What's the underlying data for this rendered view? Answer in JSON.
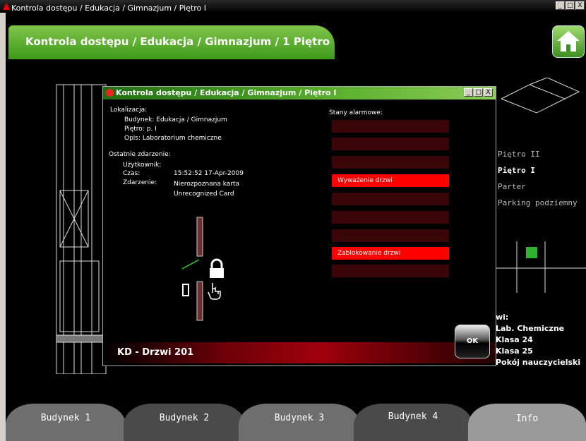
{
  "window": {
    "title": "Kontrola dostępu / Edukacja / Gimnazjum / Piętro I",
    "buttons": [
      "_",
      "□",
      "X"
    ]
  },
  "header": {
    "title": "Kontrola dostępu / Edukacja / Gimnazjum / 1 Piętro"
  },
  "floors": [
    {
      "label": "Piętro II",
      "active": false
    },
    {
      "label": "Piętro I",
      "active": true
    },
    {
      "label": "Parter",
      "active": false
    },
    {
      "label": "Parking podziemny",
      "active": false
    }
  ],
  "rooms": {
    "heading": "wi:",
    "items": [
      "Lab. Chemiczne",
      "Klasa 24",
      "Klasa 25",
      "Pokój nauczycielski"
    ]
  },
  "dialog": {
    "title": "Kontrola dostępu / Edukacja / Gimnazjum / Piętro I",
    "location_label": "Lokalizacja:",
    "building": "Budynek: Edukacja / Gimnazjum",
    "floor": "Piętro: p. I",
    "description": "Opis: Laboratorium chemiczne",
    "last_event_label": "Ostatnie zdarzenie:",
    "user_label": "Użytkownik:",
    "time_label": "Czas:",
    "time_value": "15:52:52 17-Apr-2009",
    "event_label": "Zdarzenie:",
    "event_value_1": "Nierozpoznana karta",
    "event_value_2": "Unrecognized Card",
    "alarms_label": "Stany alarmowe:",
    "alarms": [
      {
        "label": "",
        "active": false
      },
      {
        "label": "",
        "active": false
      },
      {
        "label": "",
        "active": false
      },
      {
        "label": "Wyważenie drzwi",
        "active": true
      },
      {
        "label": "",
        "active": false
      },
      {
        "label": "",
        "active": false
      },
      {
        "label": "",
        "active": false
      },
      {
        "label": "Zablokowanie drzwi",
        "active": true
      },
      {
        "label": "",
        "active": false
      }
    ],
    "footer": "KD - Drzwi 201",
    "ok_label": "OK"
  },
  "tabs": [
    "Budynek 1",
    "Budynek 2",
    "Budynek 3",
    "Budynek 4",
    "Info"
  ],
  "colors": {
    "accent_green": "#5cb02f",
    "alarm_on": "#ff0000",
    "alarm_off": "#3a0608"
  }
}
